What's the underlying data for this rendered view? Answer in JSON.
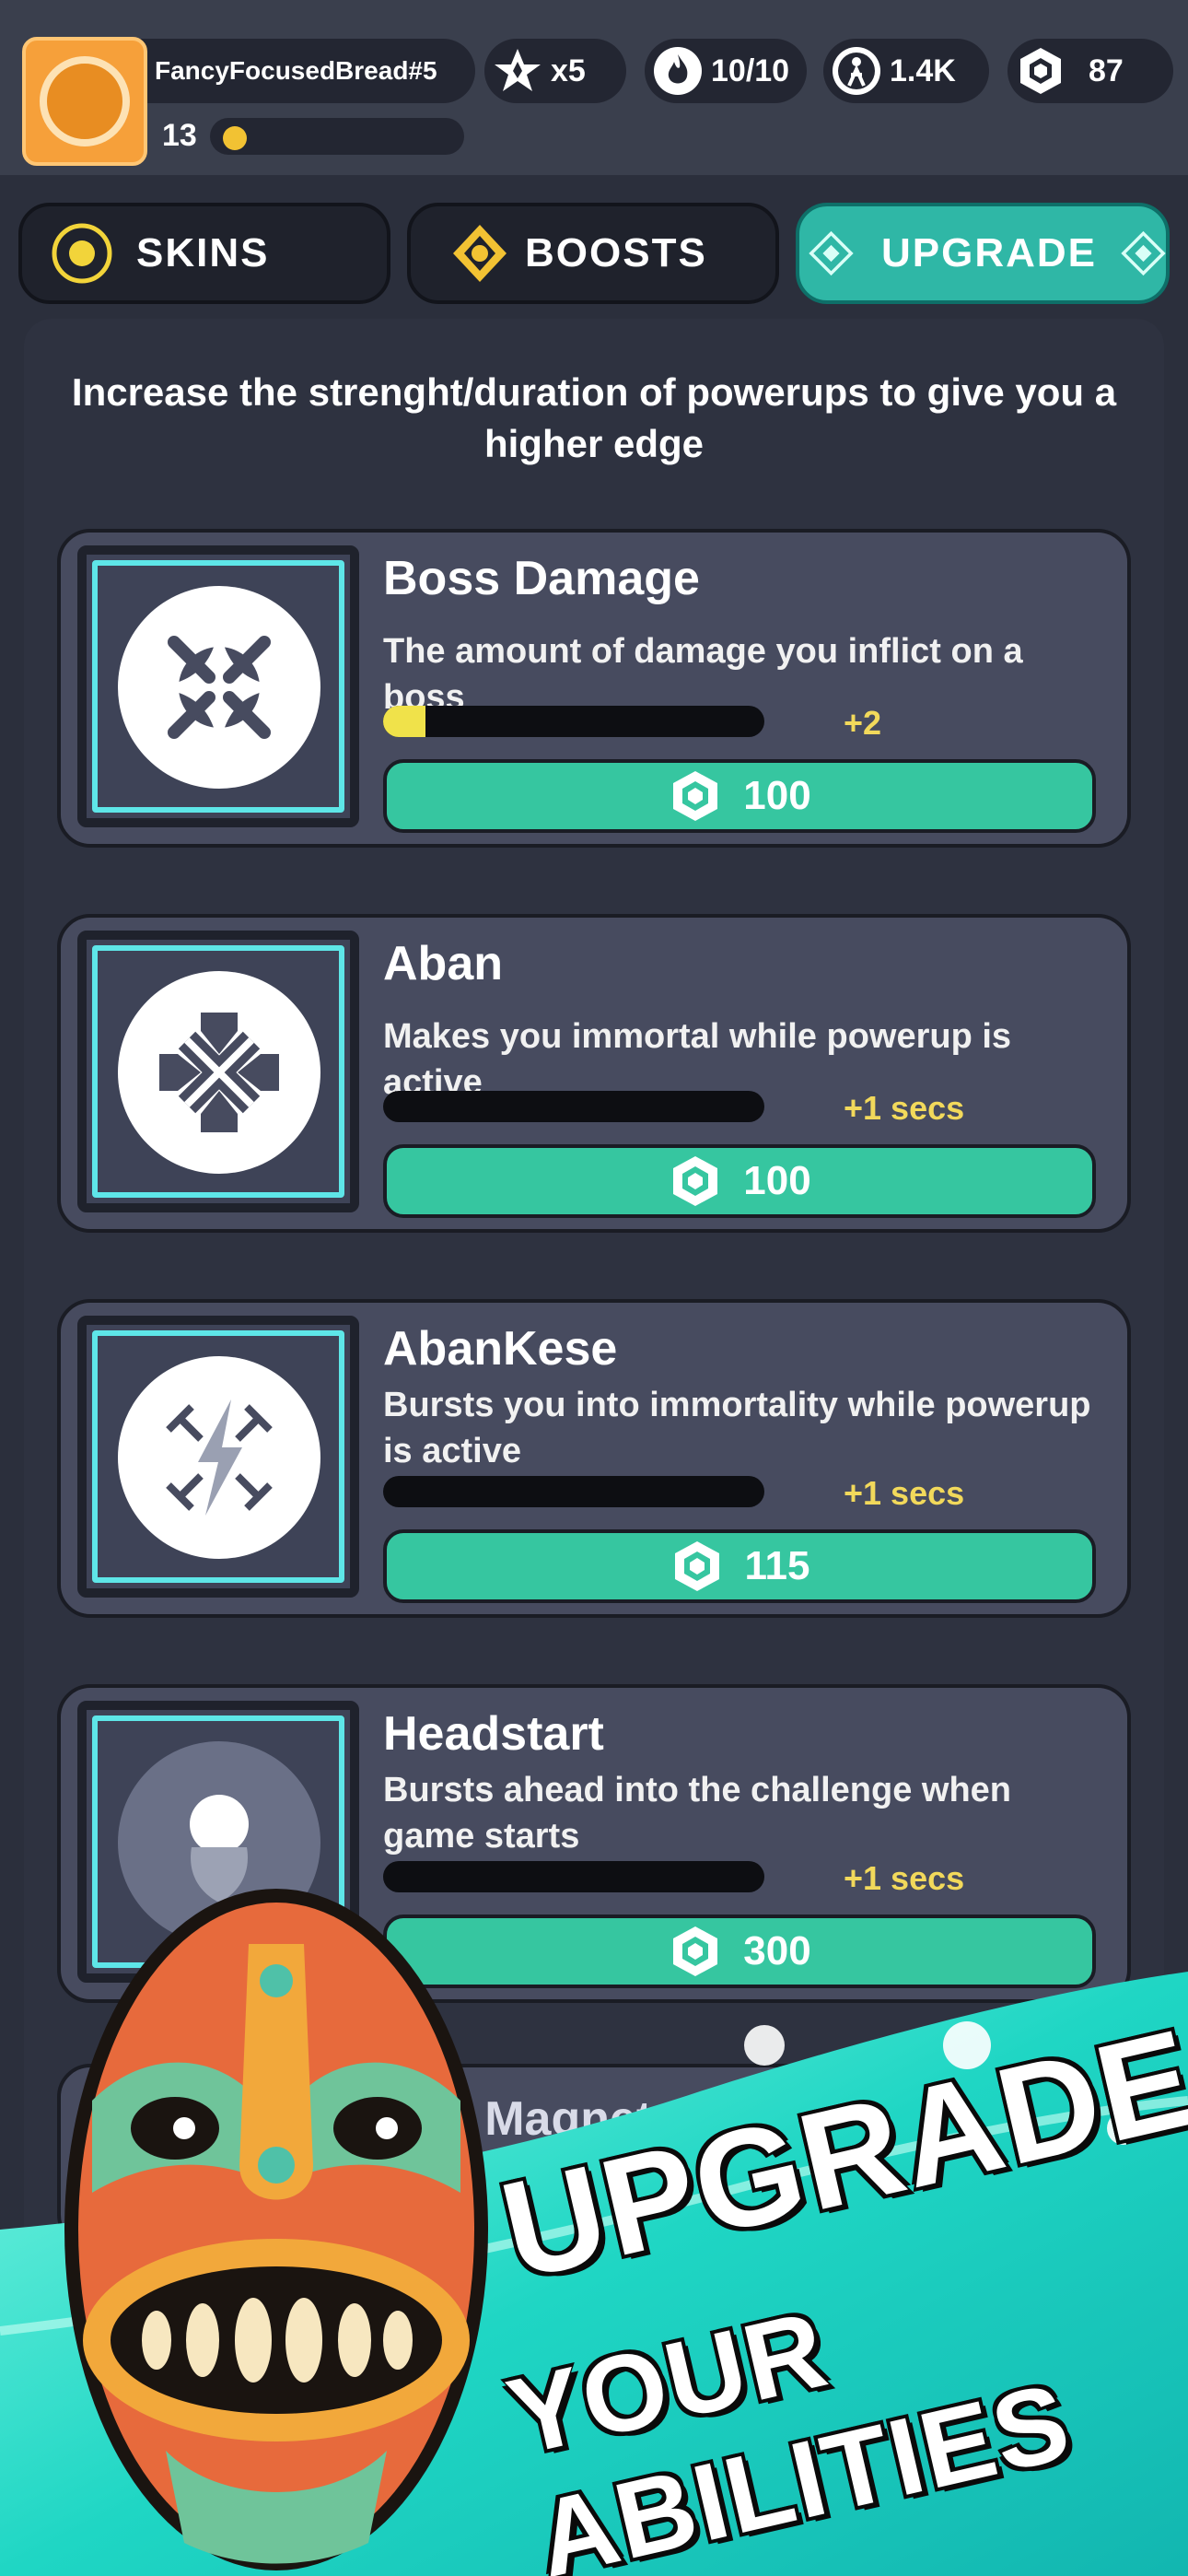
{
  "player": {
    "name": "FancyFocusedBread#5",
    "level": "13",
    "xp_progress": 0.05
  },
  "stats": [
    {
      "name": "star-token",
      "value": "x5"
    },
    {
      "name": "energy",
      "value": "10/10"
    },
    {
      "name": "friends",
      "value": "1.4K"
    },
    {
      "name": "gems",
      "value": "87"
    }
  ],
  "tabs": [
    {
      "label": "SKINS",
      "active": false
    },
    {
      "label": "BOOSTS",
      "active": false
    },
    {
      "label": "UPGRADE",
      "active": true
    }
  ],
  "intro_text": "Increase the strenght/duration of powerups to give you a higher edge",
  "upgrades": [
    {
      "title": "Boss Damage",
      "description": "The amount of damage you inflict on a boss",
      "progress": 0.11,
      "gain": "+2",
      "price": "100",
      "icon": "boss-damage-icon"
    },
    {
      "title": "Aban",
      "description": "Makes you immortal while powerup is active",
      "progress": 0,
      "gain": "+1 secs",
      "price": "100",
      "icon": "aban-icon"
    },
    {
      "title": "AbanKese",
      "description": "Bursts you into immortality while powerup is active",
      "progress": 0,
      "gain": "+1 secs",
      "price": "115",
      "icon": "abankese-icon"
    },
    {
      "title": "Headstart",
      "description": "Bursts ahead into the challenge when game starts",
      "progress": 0,
      "gain": "+1 secs",
      "price": "300",
      "icon": "headstart-icon"
    }
  ],
  "partial_card_title": "it Magnet",
  "promo": {
    "line1": "UPGRADE",
    "line2": "YOUR ABILITIES"
  },
  "colors": {
    "accent_teal": "#36c6a0",
    "active_tab": "#2fb7a6",
    "highlight_yellow": "#f2d95b"
  }
}
